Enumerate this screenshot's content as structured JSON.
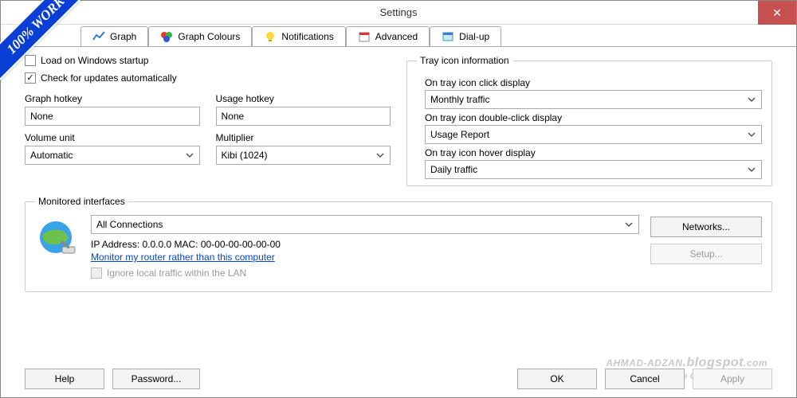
{
  "window": {
    "title": "Settings",
    "close": "✕"
  },
  "tabs": [
    {
      "label": "Graph"
    },
    {
      "label": "Graph Colours"
    },
    {
      "label": "Notifications"
    },
    {
      "label": "Advanced"
    },
    {
      "label": "Dial-up"
    }
  ],
  "left": {
    "opt_load": "Load on Windows startup",
    "opt_updates": "Check for updates automatically",
    "graph_hotkey_label": "Graph hotkey",
    "graph_hotkey": "None",
    "usage_hotkey_label": "Usage hotkey",
    "usage_hotkey": "None",
    "volume_unit_label": "Volume unit",
    "volume_unit": "Automatic",
    "multiplier_label": "Multiplier",
    "multiplier": "Kibi (1024)"
  },
  "tray": {
    "legend": "Tray icon information",
    "click_label": "On tray icon click display",
    "click_value": "Monthly traffic",
    "double_label": "On tray icon double-click display",
    "double_value": "Usage Report",
    "hover_label": "On tray icon hover display",
    "hover_value": "Daily traffic"
  },
  "monitored": {
    "legend": "Monitored interfaces",
    "connection": "All Connections",
    "ipline": "IP Address: 0.0.0.0    MAC: 00-00-00-00-00-00",
    "link": "Monitor my router rather than this computer",
    "ignore_lan": "Ignore local traffic within the LAN",
    "networks_btn": "Networks...",
    "setup_btn": "Setup..."
  },
  "footer": {
    "help": "Help",
    "password": "Password...",
    "ok": "OK",
    "cancel": "Cancel",
    "apply": "Apply"
  },
  "ribbon": "100% WORK",
  "watermark": {
    "big": "AHMAD-ADZAN",
    "suffix": ".blogspot",
    "tld": ".com",
    "small": "Download Software Gratis Full Version"
  }
}
